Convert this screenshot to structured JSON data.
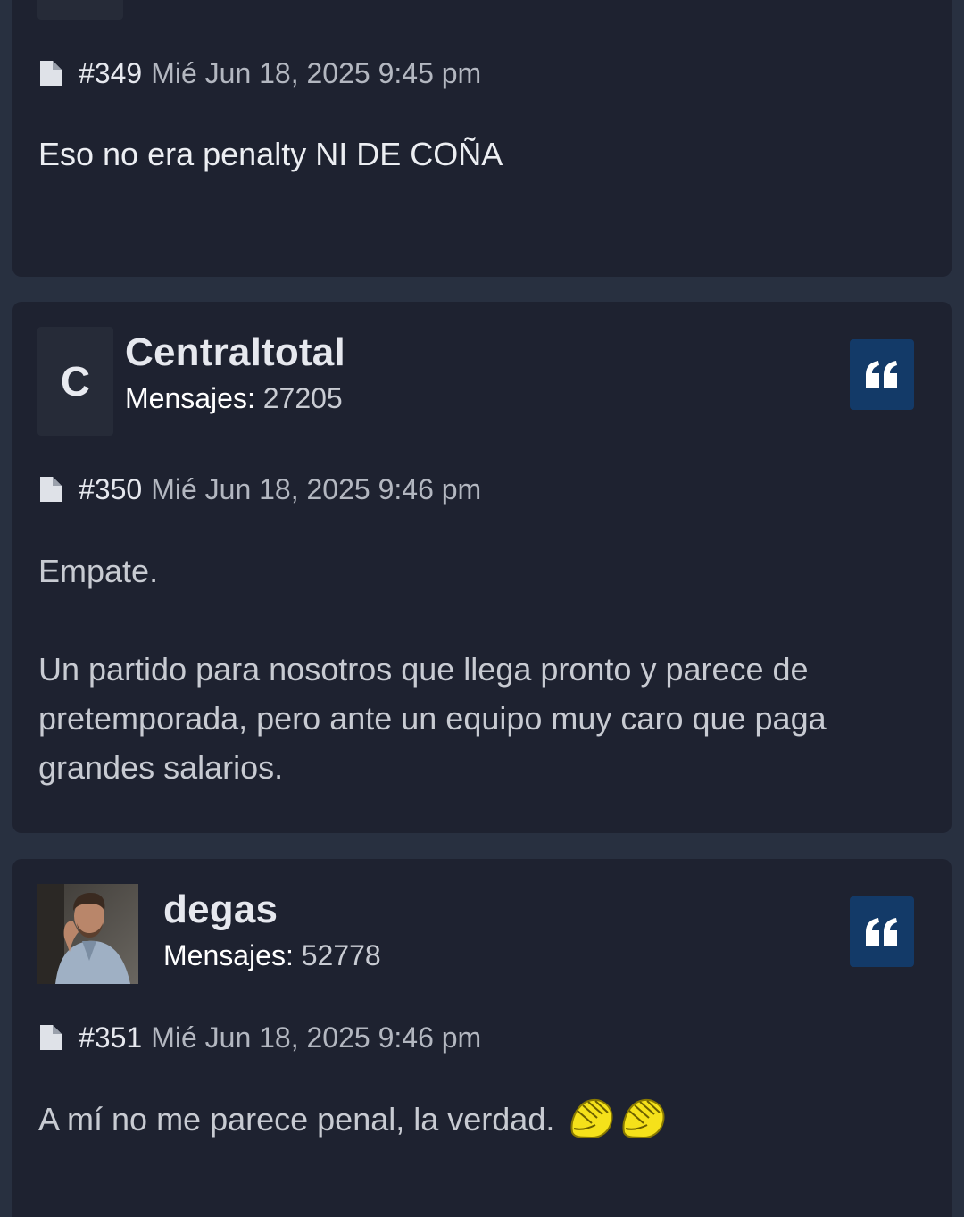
{
  "posts": [
    {
      "number": "#349",
      "date": "Mié Jun 18, 2025 9:45 pm",
      "text": "Eso no era penalty NI DE COÑA"
    },
    {
      "author": "Centraltotal",
      "avatar_letter": "C",
      "messages_label": "Mensajes:",
      "messages_count": "27205",
      "number": "#350",
      "date": "Mié Jun 18, 2025 9:46 pm",
      "paragraphs": [
        "Empate.",
        "Un partido para nosotros que llega pronto y parece de pretemporada, pero ante un equipo muy caro que paga grandes salarios."
      ]
    },
    {
      "author": "degas",
      "messages_label": "Mensajes:",
      "messages_count": "52778",
      "number": "#351",
      "date": "Mié Jun 18, 2025 9:46 pm",
      "text": "A mí no me parece penal, la verdad.",
      "emojis": [
        "facepalm-emoji",
        "facepalm-emoji"
      ]
    }
  ],
  "colors": {
    "page_background": "#283040",
    "post_background": "#1e2230",
    "quote_button": "#133a68",
    "emoji_yellow": "#f5e11a"
  },
  "icons": {
    "post_link": "document-icon",
    "quote": "quote-icon"
  }
}
